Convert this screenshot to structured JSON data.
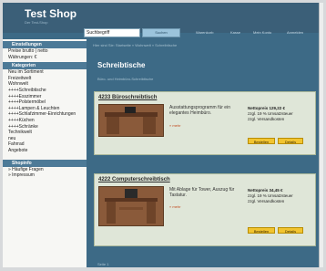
{
  "header": {
    "title": "Test Shop",
    "slogan": "Der Test-Shop",
    "search_value": "Suchbegriff",
    "search_button": "Suchen",
    "links": [
      "Warenkorb",
      "Kasse",
      "Mein Konto",
      "Anmelden"
    ]
  },
  "sidebar": {
    "sections": [
      {
        "title": "Einstellungen",
        "lines": [
          "Preise brutto | netto",
          "Währungen: €"
        ]
      },
      {
        "title": "Kategorien",
        "lines": [
          "Neu im Sortiment",
          "Freizeitwelt",
          "Wohnwelt",
          "++++Schreibtische",
          "++++Esszimmer",
          "++++Polstermöbel",
          "++++Lampen & Leuchten",
          "++++Schlafzimmer-Einrichtungen",
          "++++Küchen",
          "++++Schränke",
          "Technikwelt",
          "neu",
          "Fahrrad",
          "Angebote"
        ]
      },
      {
        "title": "Shopinfo",
        "lines": [
          "» Häufige Fragen",
          "» Impressum"
        ]
      }
    ]
  },
  "breadcrumb": "Hier sind Sie: Startseite » Wohnwelt » Schreibtische",
  "main": {
    "title": "Schreibtische",
    "subtitle": "Büro- und Heimbüro-Schreibtische"
  },
  "products": [
    {
      "title": "4233 Büroschreibtisch",
      "desc": "Ausstattungsprogramm für ein elegantes Heimbüro.",
      "more": "» mehr",
      "price_label": "Nettopreis",
      "price": "129,22 €",
      "tax": "zzgl. 19 % Umsatzsteuer",
      "ship": "zzgl. Versandkosten",
      "buy": "Bestellen",
      "details": "Details"
    },
    {
      "title": "4222 Computerschreibtisch",
      "desc": "Mit Ablage für Tower, Auszug für Tastatur.",
      "more": "» mehr",
      "price_label": "Nettopreis",
      "price": "34,45 €",
      "tax": "zzgl. 19 % Umsatzsteuer",
      "ship": "zzgl. Versandkosten",
      "buy": "Bestellen",
      "details": "Details"
    }
  ],
  "footer": "Seite 1"
}
